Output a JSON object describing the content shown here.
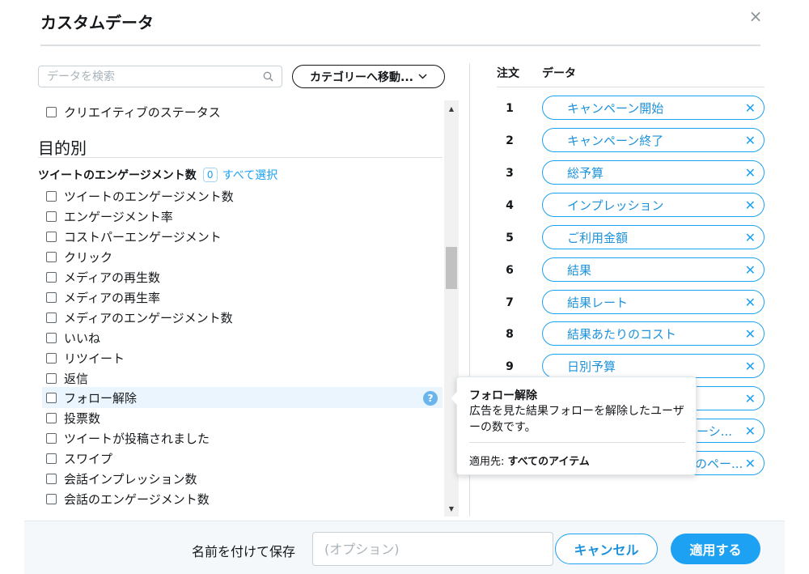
{
  "dialog": {
    "title": "カスタムデータ",
    "close_label": "×"
  },
  "search": {
    "placeholder": "データを検索",
    "icon": "search-icon"
  },
  "category_button": {
    "label": "カテゴリーへ移動...",
    "icon": "chevron-down-icon"
  },
  "left": {
    "top_item": "クリエイティブのステータス",
    "section_title": "目的別",
    "group": {
      "title": "ツイートのエンゲージメント数",
      "count": "0",
      "select_all": "すべて選択"
    },
    "items": [
      "ツイートのエンゲージメント数",
      "エンゲージメント率",
      "コストパーエンゲージメント",
      "クリック",
      "メディアの再生数",
      "メディアの再生率",
      "メディアのエンゲージメント数",
      "いいね",
      "リツイート",
      "返信",
      "フォロー解除",
      "投票数",
      "ツイートが投稿されました",
      "スワイプ",
      "会話インプレッション数",
      "会話のエンゲージメント数"
    ],
    "help_icon_text": "?"
  },
  "right": {
    "col_order": "注文",
    "col_data": "データ",
    "rows": [
      {
        "num": "1",
        "label": "キャンペーン開始"
      },
      {
        "num": "2",
        "label": "キャンペーン終了"
      },
      {
        "num": "3",
        "label": "総予算"
      },
      {
        "num": "4",
        "label": "インプレッション"
      },
      {
        "num": "5",
        "label": "ご利用金額"
      },
      {
        "num": "6",
        "label": "結果"
      },
      {
        "num": "7",
        "label": "結果レート"
      },
      {
        "num": "8",
        "label": "結果あたりのコスト"
      },
      {
        "num": "9",
        "label": "日別予算"
      },
      {
        "num": "",
        "label": ""
      },
      {
        "num": "",
        "label": "ーシ..."
      },
      {
        "num": "",
        "label": "のペー..."
      }
    ],
    "remove_label": "✕"
  },
  "tooltip": {
    "title": "フォロー解除",
    "body": "広告を見た結果フォローを解除したユーザーの数です。",
    "foot_label": "適用先:",
    "foot_value": "すべてのアイテム"
  },
  "footer": {
    "save_label": "名前を付けて保存",
    "save_placeholder": "(オプション)",
    "cancel": "キャンセル",
    "apply": "適用する"
  },
  "colors": {
    "accent": "#1da1f2",
    "text": "#14171a",
    "hover": "#eaf5fd"
  }
}
